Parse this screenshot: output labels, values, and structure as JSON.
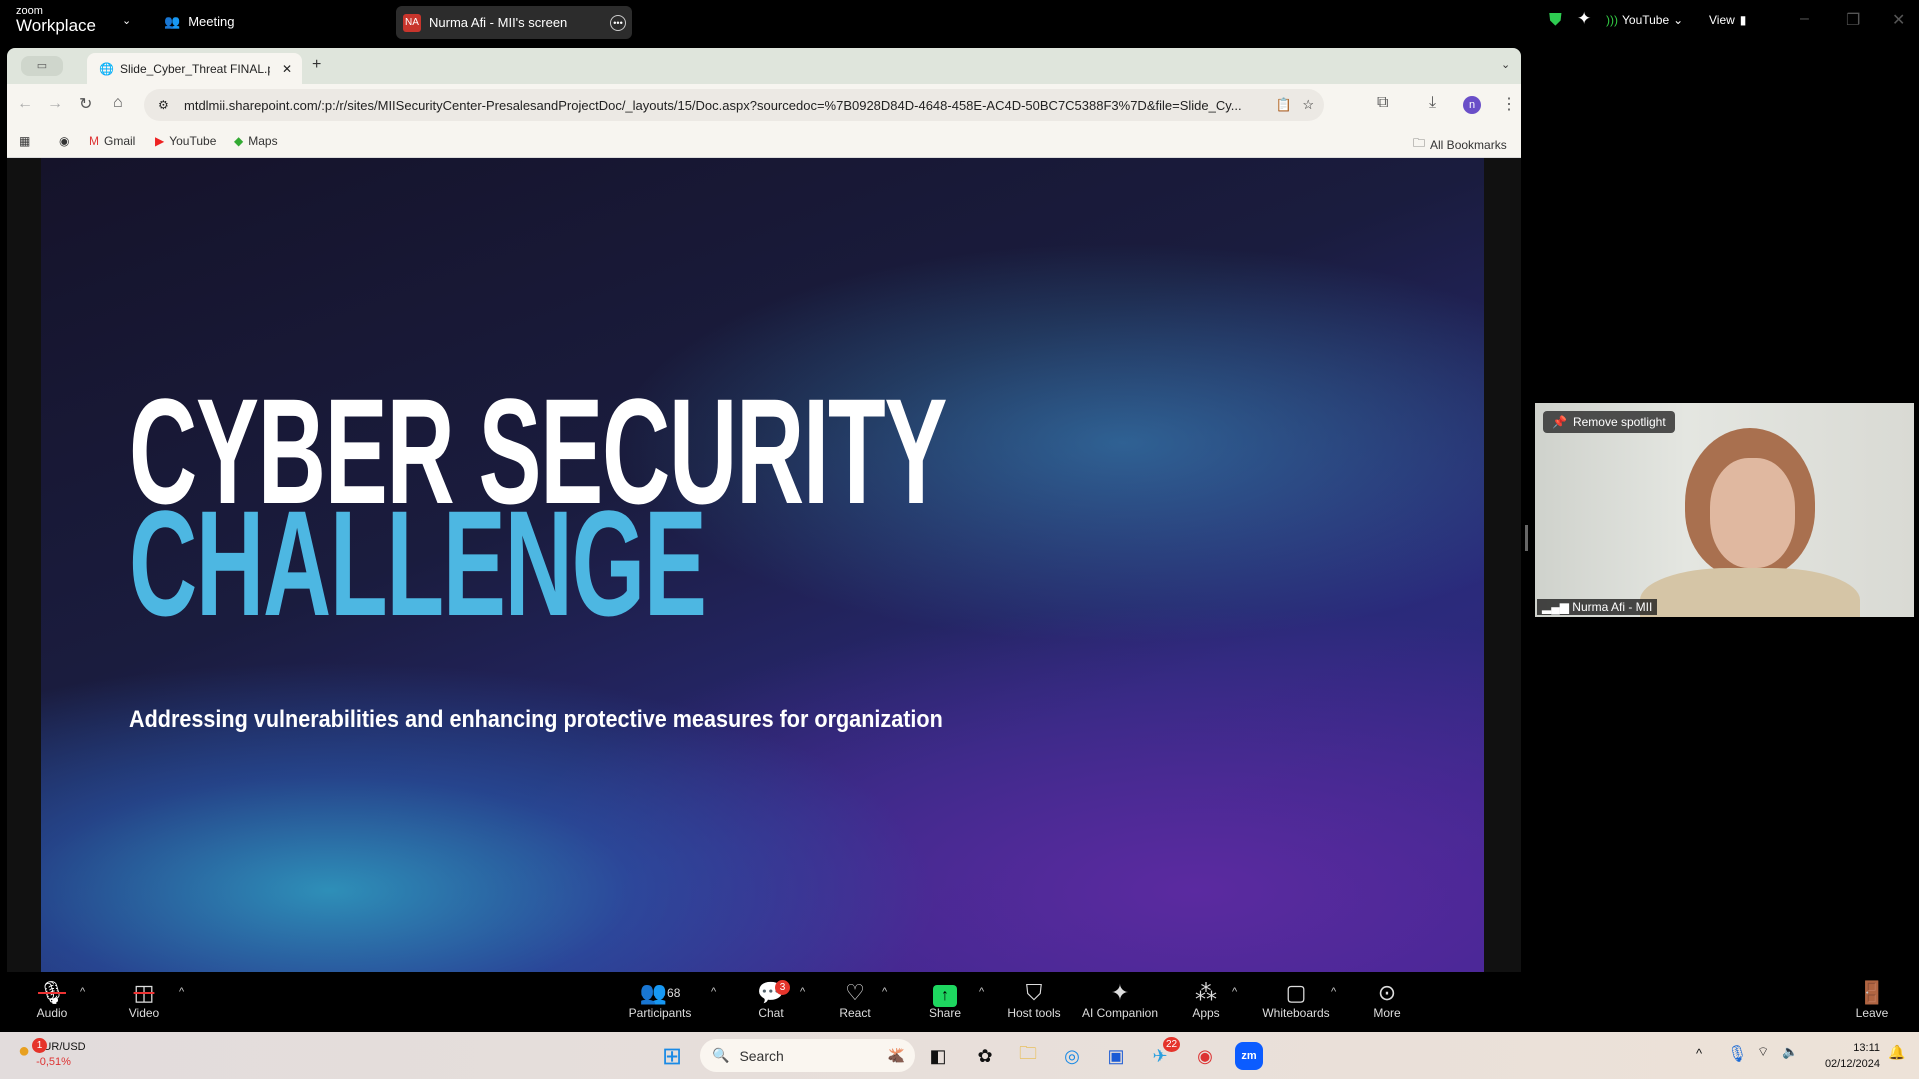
{
  "zoom": {
    "brand_small": "zoom",
    "brand": "Workplace",
    "meeting_label": "Meeting",
    "share_initials": "NA",
    "share_title": "Nurma Afi - MII's screen",
    "youtube_label": "YouTube",
    "view_label": "View"
  },
  "browser": {
    "tab_title": "Slide_Cyber_Threat FINAL.pp",
    "url": "mtdlmii.sharepoint.com/:p:/r/sites/MIISecurityCenter-PresalesandProjectDoc/_layouts/15/Doc.aspx?sourcedoc=%7B0928D84D-4648-458E-AC4D-50BC7C5388F3%7D&file=Slide_Cy...",
    "profile_initial": "n",
    "bookmarks": [
      "Gmail",
      "YouTube",
      "Maps"
    ],
    "all_bookmarks": "All Bookmarks"
  },
  "slide": {
    "title_line1": "CYBER SECURITY",
    "title_line2": "CHALLENGE",
    "subtitle": "Addressing vulnerabilities and enhancing protective measures for organization",
    "accent_color": "#4db7e2"
  },
  "video": {
    "remove_spotlight": "Remove spotlight",
    "participant_name": "Nurma Afi - MII"
  },
  "toolbar": {
    "audio": "Audio",
    "video": "Video",
    "participants": "Participants",
    "participants_count": "68",
    "chat": "Chat",
    "chat_badge": "3",
    "react": "React",
    "share": "Share",
    "host_tools": "Host tools",
    "ai_companion": "AI Companion",
    "apps": "Apps",
    "whiteboards": "Whiteboards",
    "more": "More",
    "leave": "Leave"
  },
  "taskbar": {
    "widget_badge": "1",
    "widget_title": "EUR/USD",
    "widget_value": "-0,51%",
    "search_placeholder": "Search",
    "telegram_badge": "22",
    "time": "13:11",
    "date": "02/12/2024"
  }
}
